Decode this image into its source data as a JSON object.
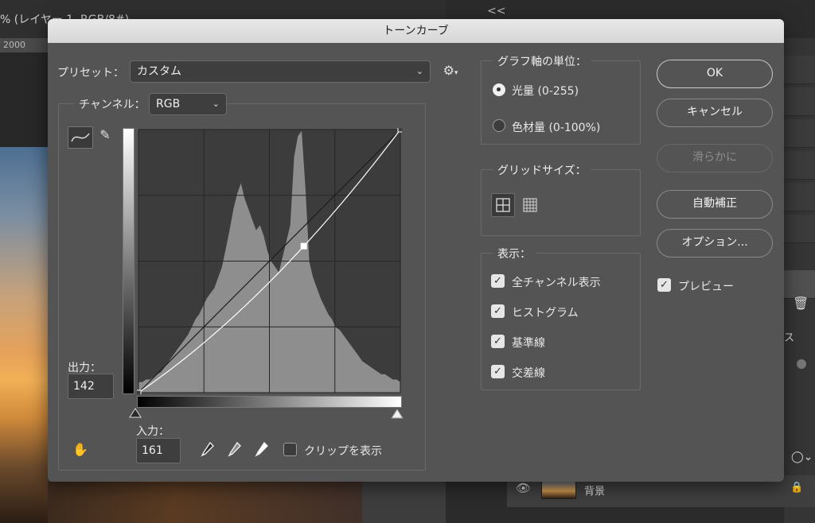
{
  "background": {
    "doc_title": "% (レイヤー 1, RGB/8#)",
    "ruler_value": "2000",
    "collapse_glyph": "<<",
    "layer_name": "背景",
    "side_text": "ス"
  },
  "dialog": {
    "title": "トーンカーブ",
    "preset": {
      "label": "プリセット：",
      "value": "カスタム"
    },
    "channel": {
      "label": "チャンネル：",
      "value": "RGB"
    },
    "output": {
      "label": "出力：",
      "value": "142"
    },
    "input": {
      "label": "入力：",
      "value": "161"
    },
    "show_clipping": {
      "label": "クリップを表示",
      "checked": false
    },
    "graph_unit": {
      "title": "グラフ軸の単位：",
      "options": [
        {
          "label": "光量 (0-255)",
          "selected": true
        },
        {
          "label": "色材量 (0-100%)",
          "selected": false
        }
      ]
    },
    "grid_size": {
      "title": "グリッドサイズ："
    },
    "display": {
      "title": "表示：",
      "options": [
        {
          "label": "全チャンネル表示",
          "checked": true
        },
        {
          "label": "ヒストグラム",
          "checked": true
        },
        {
          "label": "基準線",
          "checked": true
        },
        {
          "label": "交差線",
          "checked": true
        }
      ]
    },
    "buttons": {
      "ok": "OK",
      "cancel": "キャンセル",
      "smooth": "滑らかに",
      "auto": "自動補正",
      "options": "オプション..."
    },
    "preview": {
      "label": "プレビュー",
      "checked": true
    }
  },
  "curve": {
    "input_range": [
      0,
      255
    ],
    "output_range": [
      0,
      255
    ],
    "points": [
      [
        0,
        0
      ],
      [
        161,
        142
      ],
      [
        255,
        255
      ]
    ],
    "histogram": [
      4,
      4,
      5,
      5,
      6,
      7,
      8,
      10,
      12,
      14,
      16,
      18,
      20,
      22,
      25,
      28,
      30,
      33,
      36,
      38,
      40,
      44,
      48,
      55,
      62,
      70,
      76,
      80,
      74,
      70,
      66,
      62,
      64,
      60,
      54,
      50,
      48,
      46,
      52,
      58,
      64,
      90,
      98,
      100,
      78,
      50,
      44,
      40,
      36,
      33,
      30,
      28,
      25,
      24,
      22,
      20,
      18,
      16,
      14,
      12,
      11,
      10,
      9,
      8,
      7,
      7,
      6,
      5,
      5,
      4
    ]
  },
  "colors": {
    "dialog_bg": "#545454",
    "graph_bg": "#3c3c3c",
    "histogram": "#8e8e8e",
    "curve": "#ffffff"
  }
}
